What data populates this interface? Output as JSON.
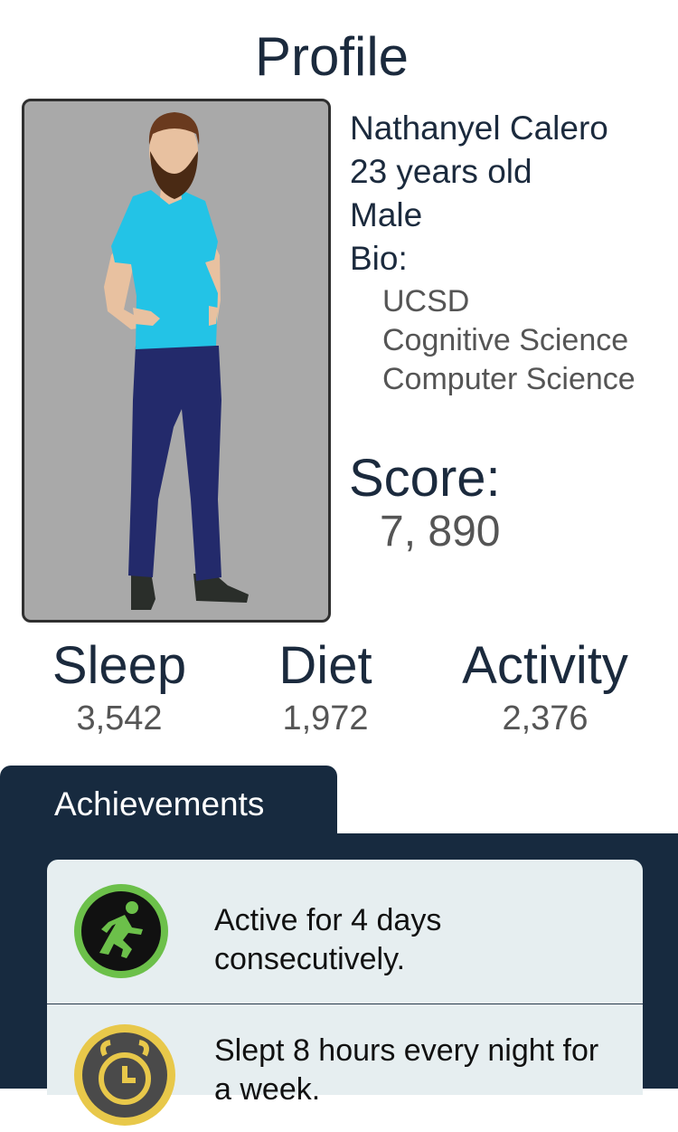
{
  "page": {
    "title": "Profile"
  },
  "profile": {
    "name": "Nathanyel Calero",
    "age": "23 years old",
    "gender": "Male",
    "bio_label": "Bio:",
    "bio": [
      "UCSD",
      "Cognitive Science",
      "Computer Science"
    ]
  },
  "score": {
    "label": "Score:",
    "value": "7, 890"
  },
  "stats": [
    {
      "label": "Sleep",
      "value": "3,542"
    },
    {
      "label": "Diet",
      "value": "1,972"
    },
    {
      "label": "Activity",
      "value": "2,376"
    }
  ],
  "achievements": {
    "tab_label": "Achievements",
    "items": [
      {
        "text": "Active for 4 days consecutively.",
        "icon": "running-person-icon"
      },
      {
        "text": "Slept 8 hours every night for a week.",
        "icon": "alarm-clock-icon"
      }
    ]
  },
  "colors": {
    "navy": "#172a3f",
    "text": "#1b2a3d",
    "muted": "#555555",
    "avatar_bg": "#a9a9a9",
    "achievement_bg": "#e6eef0",
    "activity_green": "#6cc04a",
    "sleep_gold": "#e8c84a"
  }
}
